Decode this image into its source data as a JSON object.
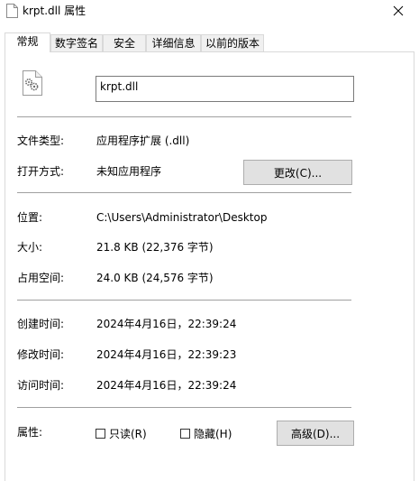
{
  "window": {
    "title": "krpt.dll 属性",
    "file_icon": "dll-file-gear-icon",
    "close_icon": "close-icon"
  },
  "tabs": [
    {
      "label": "常规",
      "active": true
    },
    {
      "label": "数字签名",
      "active": false
    },
    {
      "label": "安全",
      "active": false
    },
    {
      "label": "详细信息",
      "active": false
    },
    {
      "label": "以前的版本",
      "active": false
    }
  ],
  "general": {
    "filename": "krpt.dll",
    "file_type_label": "文件类型:",
    "file_type_value": "应用程序扩展 (.dll)",
    "open_with_label": "打开方式:",
    "open_with_value": "未知应用程序",
    "change_button": "更改(C)...",
    "location_label": "位置:",
    "location_value": "C:\\Users\\Administrator\\Desktop",
    "size_label": "大小:",
    "size_value": "21.8 KB (22,376 字节)",
    "size_on_disk_label": "占用空间:",
    "size_on_disk_value": "24.0 KB (24,576 字节)",
    "created_label": "创建时间:",
    "created_value": "2024年4月16日，22:39:24",
    "modified_label": "修改时间:",
    "modified_value": "2024年4月16日，22:39:23",
    "accessed_label": "访问时间:",
    "accessed_value": "2024年4月16日，22:39:24",
    "attributes_label": "属性:",
    "readonly_label": "只读(R)",
    "readonly_checked": false,
    "hidden_label": "隐藏(H)",
    "hidden_checked": false,
    "advanced_button": "高级(D)..."
  }
}
